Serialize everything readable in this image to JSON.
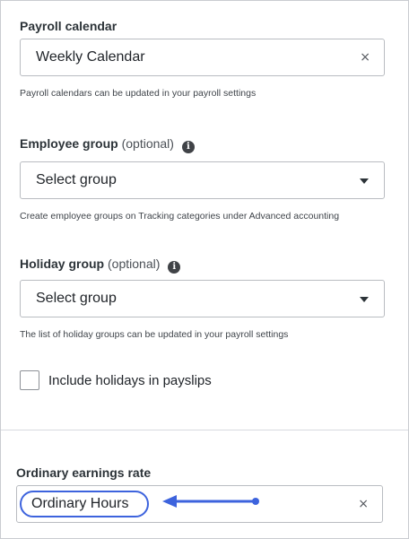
{
  "payroll_calendar": {
    "label": "Payroll calendar",
    "value": "Weekly Calendar",
    "clear": "×",
    "help": "Payroll calendars can be updated in your payroll settings"
  },
  "employee_group": {
    "label": "Employee group",
    "optional": "(optional)",
    "info": "i",
    "value": "Select group",
    "help": "Create employee groups on Tracking categories under Advanced accounting"
  },
  "holiday_group": {
    "label": "Holiday group",
    "optional": "(optional)",
    "info": "i",
    "value": "Select group",
    "help": "The list of holiday groups can be updated in your payroll settings"
  },
  "include_holidays": {
    "label": "Include holidays in payslips",
    "checked": false
  },
  "ordinary_earnings": {
    "label": "Ordinary earnings rate",
    "value": "Ordinary Hours",
    "clear": "×",
    "highlight_color": "#3d63dd"
  }
}
